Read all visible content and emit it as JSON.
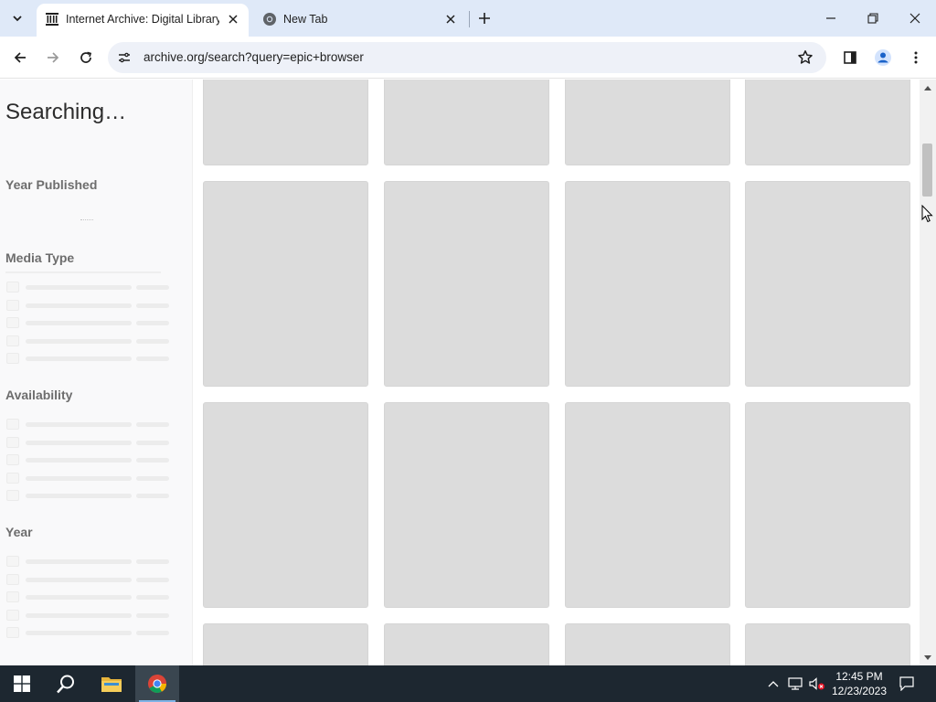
{
  "browser": {
    "tabs": [
      {
        "title": "Internet Archive: Digital Library",
        "icon": "internet-archive-icon",
        "active": true
      },
      {
        "title": "New Tab",
        "icon": "chrome-icon",
        "active": false
      }
    ],
    "url": "archive.org/search?query=epic+browser"
  },
  "sidebar": {
    "heading": "Searching…",
    "facets": [
      {
        "title": "Year Published"
      },
      {
        "title": "Media Type"
      },
      {
        "title": "Availability"
      },
      {
        "title": "Year"
      }
    ]
  },
  "results": {
    "state": "loading",
    "columns": 4
  },
  "taskbar": {
    "time": "12:45 PM",
    "date": "12/23/2023",
    "apps": [
      "windows-start-icon",
      "search-icon",
      "file-explorer-icon",
      "chrome-icon"
    ]
  },
  "colors": {
    "tabbar_bg": "#dfe9f8",
    "skeleton_tile": "#dcdcdc",
    "taskbar_bg": "#1d2730"
  }
}
